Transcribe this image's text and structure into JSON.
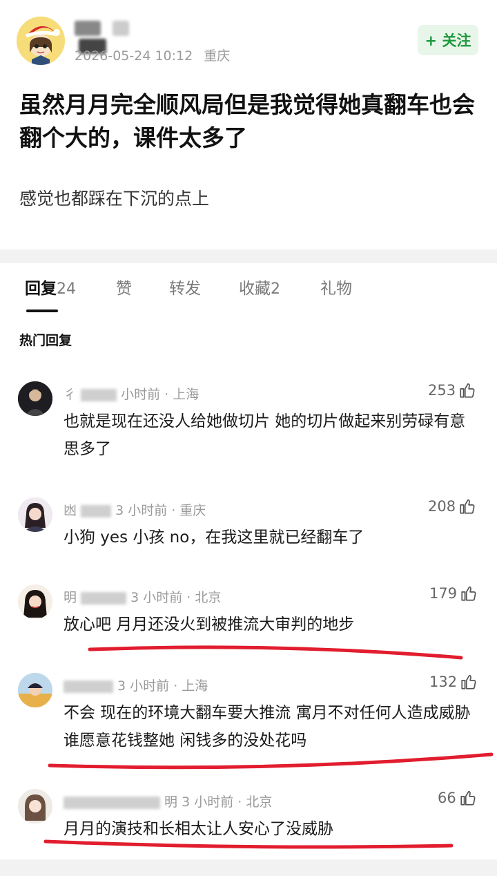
{
  "post": {
    "timestamp": "2026-05-24 10:12",
    "location": "重庆",
    "follow_label": "+ 关注",
    "title": "虽然月月完全顺风局但是我觉得她真翻车也会翻个大的，课件太多了",
    "body": "感觉也都踩在下沉的点上"
  },
  "tabs": [
    {
      "label": "回复",
      "count": "24",
      "active": true
    },
    {
      "label": "赞",
      "count": ""
    },
    {
      "label": "转发",
      "count": ""
    },
    {
      "label": "收藏",
      "count": "2"
    },
    {
      "label": "礼物",
      "count": ""
    }
  ],
  "section_title": "热门回复",
  "comments": [
    {
      "name_visible": "彳",
      "meta": "小时前 · 上海",
      "likes": "253",
      "text": "也就是现在还没人给她做切片 她的切片做起来别劳碌有意思多了"
    },
    {
      "name_visible": "凼",
      "meta": "3 小时前 · 重庆",
      "likes": "208",
      "text": "小狗 yes 小孩 no，在我这里就已经翻车了"
    },
    {
      "name_visible": "明",
      "meta": "3 小时前 · 北京",
      "likes": "179",
      "text": "放心吧 月月还没火到被推流大审判的地步"
    },
    {
      "name_visible": "",
      "meta": "3 小时前 · 上海",
      "likes": "132",
      "text": "不会 现在的环境大翻车要大推流 寓月不对任何人造成威胁 谁愿意花钱整她 闲钱多的没处花吗"
    },
    {
      "name_visible": "明",
      "meta": "3 小时前 · 北京",
      "likes": "66",
      "text": "月月的演技和长相太让人安心了没威胁"
    }
  ],
  "icons": {
    "like": "thumbs-up-icon",
    "follow": "plus-icon"
  },
  "colors": {
    "accent_green": "#1f9a3d",
    "annotation_red": "#e11d2e"
  }
}
